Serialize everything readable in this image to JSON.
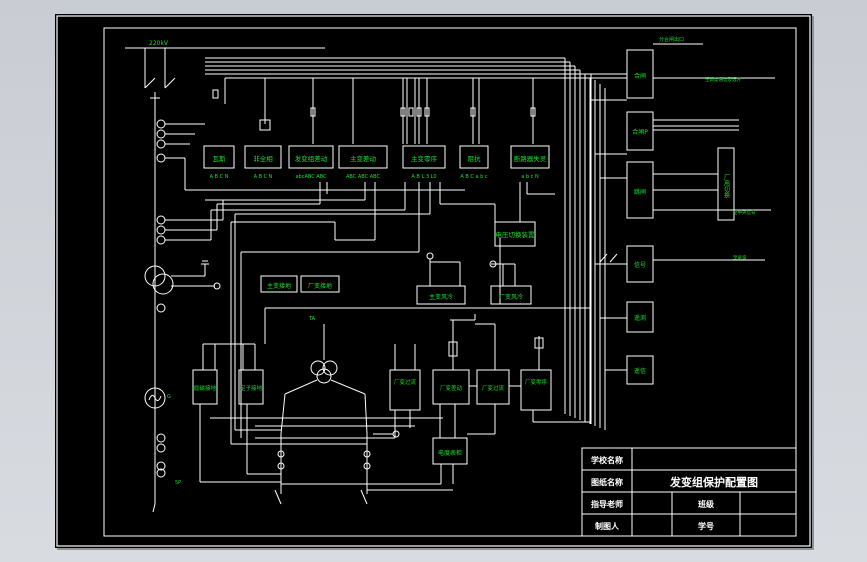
{
  "colors": {
    "background": "#000000",
    "line": "#ffffff",
    "text": "#18e02c",
    "viewport": "#cfd3d9"
  },
  "top_left_label": "220kV",
  "top_right_label": "分合闸出口",
  "right_label_1": "至调度通信及远方",
  "right_label_2": "至中央信号",
  "right_label_3": "至录波",
  "top_protections": [
    "瓦斯",
    "非全相",
    "发变组差动",
    "主变差动",
    "主变零序",
    "阻抗",
    "断路器失灵"
  ],
  "top_terminals": [
    "A B C N",
    "A B C N",
    "abcABC ABC",
    "ABC ABC ABC",
    "A B L 3 L0",
    "A B C a b c",
    "a b c N"
  ],
  "voltage_switch": "电压切换装置",
  "cooling_1": "主变风冷",
  "cooling_2": "厂变风冷",
  "ground_1": "主变接地",
  "ground_2": "厂变接地",
  "right_boxes": [
    "合闸",
    "合闸P",
    "跳闸",
    "信号",
    "遥测",
    "遥信"
  ],
  "switch_group": "厂用切换",
  "lower_protections": [
    "励磁接地",
    "定子接地",
    "厂变过流",
    "厂变差动",
    "厂变过流",
    "厂变零序"
  ],
  "meter_box": "电度表柜",
  "title_block": {
    "school_label": "学校名称",
    "drawing_label": "图纸名称",
    "drawing_title": "发变组保护配置图",
    "teacher_label": "指导老师",
    "class_label": "班级",
    "drafter_label": "制图人",
    "student_no_label": "学号"
  },
  "small_labels": {
    "vt_note": "5P",
    "gen_note": "G",
    "mid_note": "TA"
  }
}
